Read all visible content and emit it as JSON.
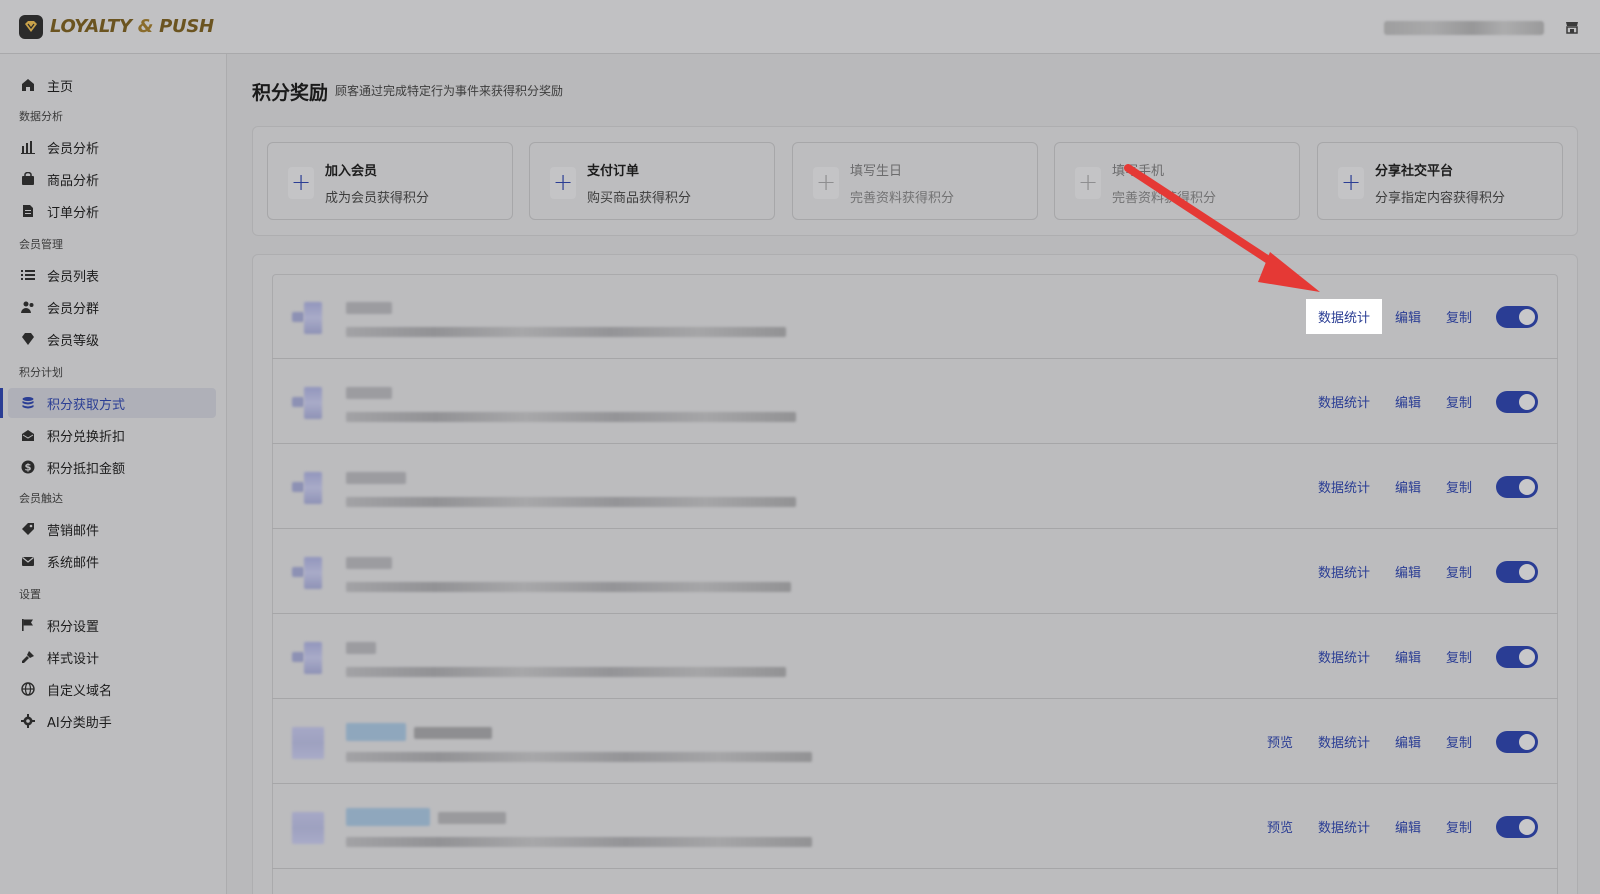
{
  "app": {
    "brand_left": "LOYALTY",
    "brand_amp": " & ",
    "brand_right": "PUSH"
  },
  "sidebar": {
    "home": "主页",
    "sections": {
      "analytics": "数据分析",
      "members": "会员管理",
      "points": "积分计划",
      "outreach": "会员触达",
      "settings": "设置"
    },
    "items": {
      "member_analysis": "会员分析",
      "product_analysis": "商品分析",
      "order_analysis": "订单分析",
      "member_list": "会员列表",
      "member_segments": "会员分群",
      "member_tiers": "会员等级",
      "earn_points": "积分获取方式",
      "redeem_discount": "积分兑换折扣",
      "points_credit": "积分抵扣金额",
      "marketing_email": "营销邮件",
      "system_email": "系统邮件",
      "points_settings": "积分设置",
      "style_design": "样式设计",
      "custom_domain": "自定义域名",
      "ai_assistant": "AI分类助手"
    },
    "active": "earn_points"
  },
  "page": {
    "title": "积分奖励",
    "subtitle": "顾客通过完成特定行为事件来获得积分奖励"
  },
  "action_cards": [
    {
      "title": "加入会员",
      "desc": "成为会员获得积分",
      "enabled": true
    },
    {
      "title": "支付订单",
      "desc": "购买商品获得积分",
      "enabled": true
    },
    {
      "title": "填写生日",
      "desc": "完善资料获得积分",
      "enabled": false
    },
    {
      "title": "填写手机",
      "desc": "完善资料获得积分",
      "enabled": false
    },
    {
      "title": "分享社交平台",
      "desc": "分享指定内容获得积分",
      "enabled": true
    }
  ],
  "row_actions": {
    "preview": "预览",
    "stats": "数据统计",
    "edit": "编辑",
    "copy": "复制"
  },
  "rows": [
    {
      "has_preview": false,
      "enabled": true,
      "highlight_stats": true
    },
    {
      "has_preview": false,
      "enabled": true
    },
    {
      "has_preview": false,
      "enabled": true
    },
    {
      "has_preview": false,
      "enabled": true
    },
    {
      "has_preview": false,
      "enabled": true
    },
    {
      "has_preview": true,
      "enabled": true
    },
    {
      "has_preview": true,
      "enabled": true
    }
  ],
  "colors": {
    "accent": "#2a3d94",
    "brand": "#6b5420",
    "annotation_arrow": "#e53935"
  }
}
